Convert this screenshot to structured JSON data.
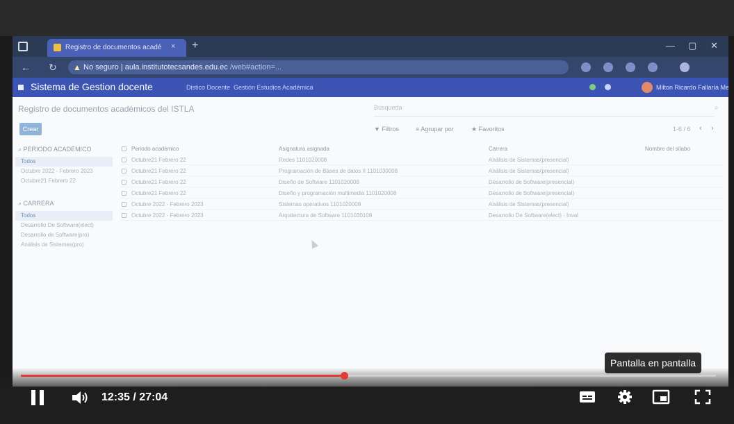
{
  "browser": {
    "tab_title": "Registro de documentos acadé",
    "tab_close": "×",
    "tab_new": "+",
    "window_controls": [
      "—",
      "▢",
      "✕"
    ],
    "security_label": "No seguro",
    "url": "aula.institutotecsandes.edu.ec",
    "url_rest": "/web#action=...",
    "warning_symbol": "▲"
  },
  "app": {
    "title": "Sistema de Gestion docente",
    "menu": [
      "Distico Docente",
      "Gestión Estudios Académica"
    ],
    "user_name": "Milton Ricardo Fallaría Mendoza"
  },
  "page": {
    "title": "Registro de documentos académicos del ISTLA",
    "search_placeholder": "Búsqueda",
    "create_label": "Crear",
    "filters_label": "▼ Filtros",
    "group_label": "≡ Agrupar por",
    "favorites_label": "★ Favoritos",
    "pager": "1-6 / 6",
    "pager_prev": "‹",
    "pager_next": "›"
  },
  "sidebar": {
    "periodo_heading": "PERIODO ACADÉMICO",
    "periodo_items": [
      "Todos",
      "Octubre 2022 - Febrero 2023",
      "Octubre21 Febrero 22"
    ],
    "carrera_heading": "CARRERA",
    "carrera_items": [
      "Todos",
      "Desarrollo De Software(elect)",
      "Desarrollo de Software(pro)",
      "Análisis de Sistemas(pro)"
    ]
  },
  "table": {
    "headers": [
      "Periodo académico",
      "Asignatura asignada",
      "Carrera",
      "Nombre del sílabo"
    ],
    "rows": [
      [
        "Octubre21 Febrero 22",
        "Redes 1101020008",
        "Análisis de Sistemas(presencial)",
        ""
      ],
      [
        "Octubre21 Febrero 22",
        "Programación de Bases de datos II 1101030008",
        "Análisis de Sistemas(presencial)",
        ""
      ],
      [
        "Octubre21 Febrero 22",
        "Diseño de Software 1101020008",
        "Desarrollo de Software(presencial)",
        ""
      ],
      [
        "Octubre21 Febrero 22",
        "Diseño y programación multimedia 1101020008",
        "Desarrollo de Software(presencial)",
        ""
      ],
      [
        "Octubre 2022 - Febrero 2023",
        "Sistemas operativos 1101020008",
        "Análisis de Sistemas(presencial)",
        ""
      ],
      [
        "Octubre 2022 - Febrero 2023",
        "Arquitectura de Software 1101030108",
        "Desarrollo De Software(elect) - Inval",
        ""
      ]
    ]
  },
  "video": {
    "current_time": "12:35",
    "duration": "27:04",
    "time_display": "12:35 / 27:04",
    "progress_fraction": 0.465,
    "tooltip": "Pantalla en pantalla",
    "accent_color": "#e53935"
  }
}
